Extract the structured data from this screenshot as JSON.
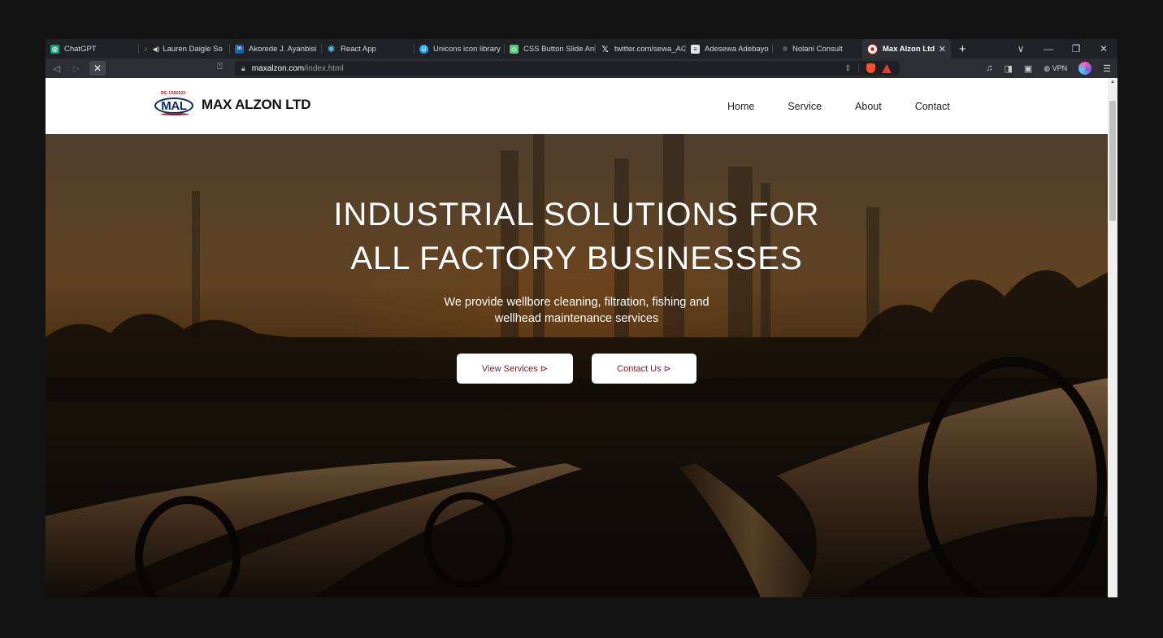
{
  "browser": {
    "tabs": [
      {
        "label": "ChatGPT",
        "icon": "chatgpt-icon",
        "color": "#10a37f"
      },
      {
        "label": "Lauren Daigle So",
        "icon": "music-icon",
        "color": "#1ed760",
        "audio": "◀)"
      },
      {
        "label": "Akorede J. Ayanbisi",
        "icon": "linkedin-icon",
        "color": "#0a66c2"
      },
      {
        "label": "React App",
        "icon": "react-icon",
        "color": "#61dafb"
      },
      {
        "label": "Unicons icon library",
        "icon": "unicons-icon",
        "color": "#1da1f2"
      },
      {
        "label": "CSS Button Slide Ani",
        "icon": "codepen-icon",
        "color": "#47cf73"
      },
      {
        "label": "twitter.com/sewa_AG",
        "icon": "x-icon",
        "color": "#000000"
      },
      {
        "label": "Adesewa Adebayo",
        "icon": "document-icon",
        "color": "#e6e6e6"
      },
      {
        "label": "Nolani Consult",
        "icon": "dot-icon",
        "color": "#555555"
      },
      {
        "label": "Max Alzon Ltd",
        "icon": "site-icon",
        "color": "#c1121f",
        "active": true
      }
    ],
    "new_tab": "+",
    "url_host": "maxalzon.com",
    "url_path": "/index.html",
    "vpn_label": "VPN"
  },
  "site": {
    "logo_rc": "RC-1582622",
    "logo_mark": "MAL",
    "brand": "MAX ALZON LTD",
    "nav": [
      "Home",
      "Service",
      "About",
      "Contact"
    ]
  },
  "hero": {
    "title_line1": "INDUSTRIAL SOLUTIONS FOR",
    "title_line2": "ALL FACTORY BUSINESSES",
    "subtitle_line1": "We provide wellbore cleaning, filtration, fishing and",
    "subtitle_line2": "wellhead maintenance services",
    "btn_services": "View Services ⊳",
    "btn_contact": "Contact Us ⊳"
  }
}
